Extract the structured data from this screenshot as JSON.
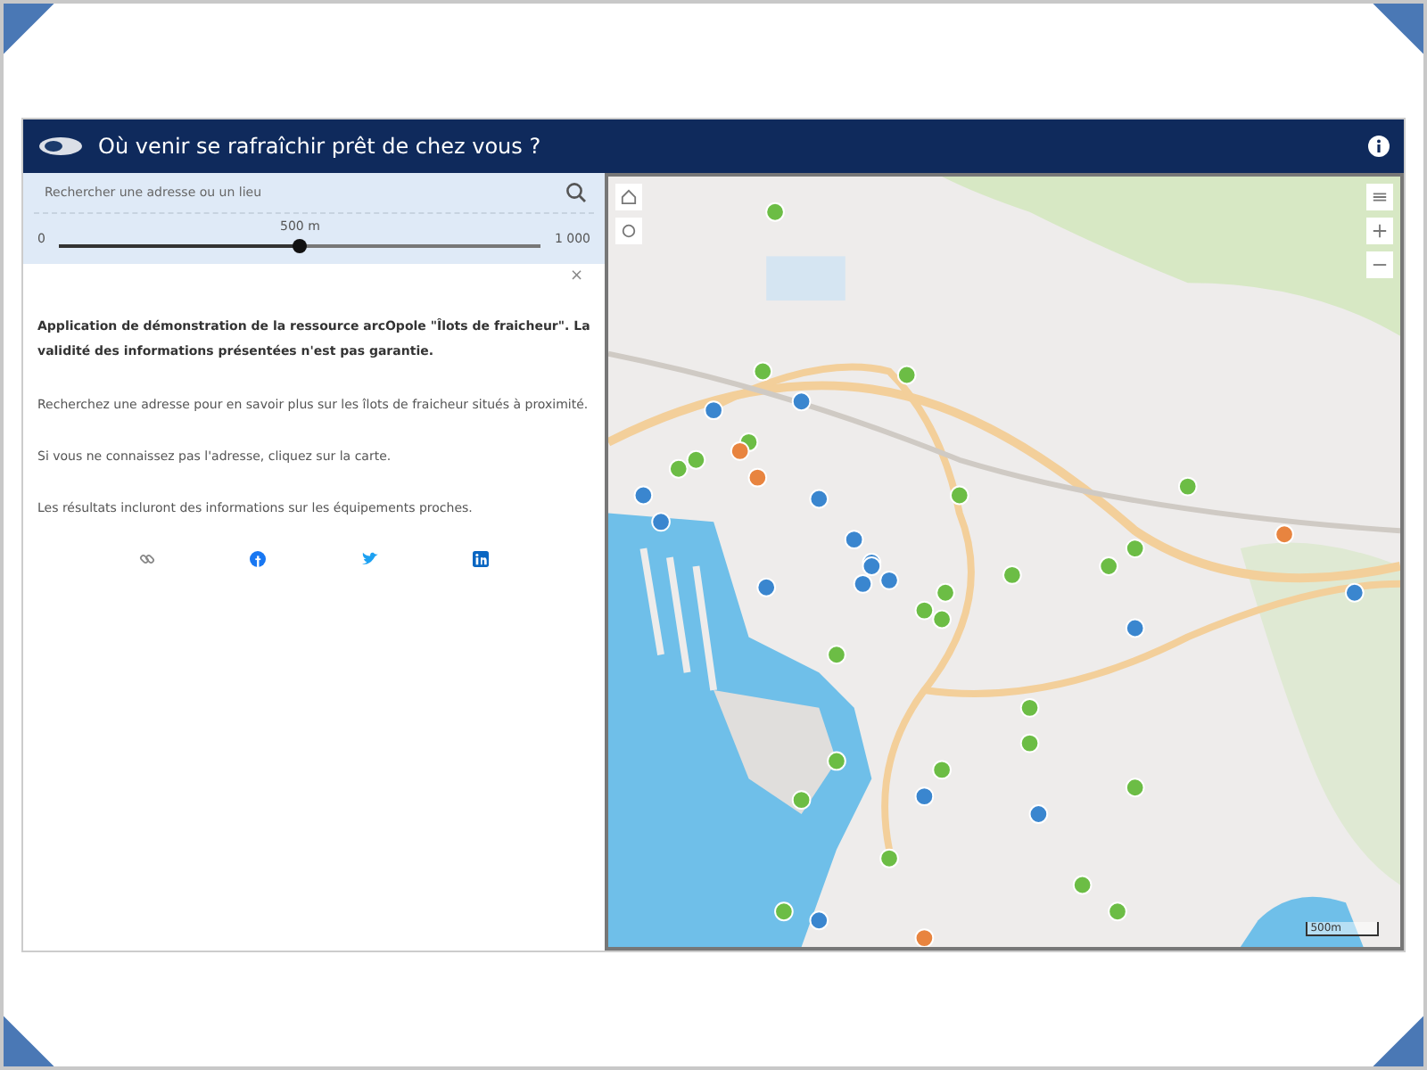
{
  "header": {
    "title": "Où venir se rafraîchir prêt de chez vous ?"
  },
  "search": {
    "placeholder": "Rechercher une adresse ou un lieu"
  },
  "distance_slider": {
    "min_label": "0",
    "value_label": "500 m",
    "max_label": "1 000",
    "level": 0.5
  },
  "panel": {
    "close": "×",
    "intro": "Application de démonstration de la ressource arcOpole \"Îlots de fraicheur\". La validité des informations présentées n'est pas garantie.",
    "paragraphs": [
      "Recherchez une adresse pour en savoir plus sur les îlots de fraicheur situés à proximité.",
      "Si vous ne connaissez pas l'adresse, cliquez sur la carte.",
      "Les résultats incluront des informations sur les équipements proches."
    ]
  },
  "map": {
    "scale": "500m"
  }
}
